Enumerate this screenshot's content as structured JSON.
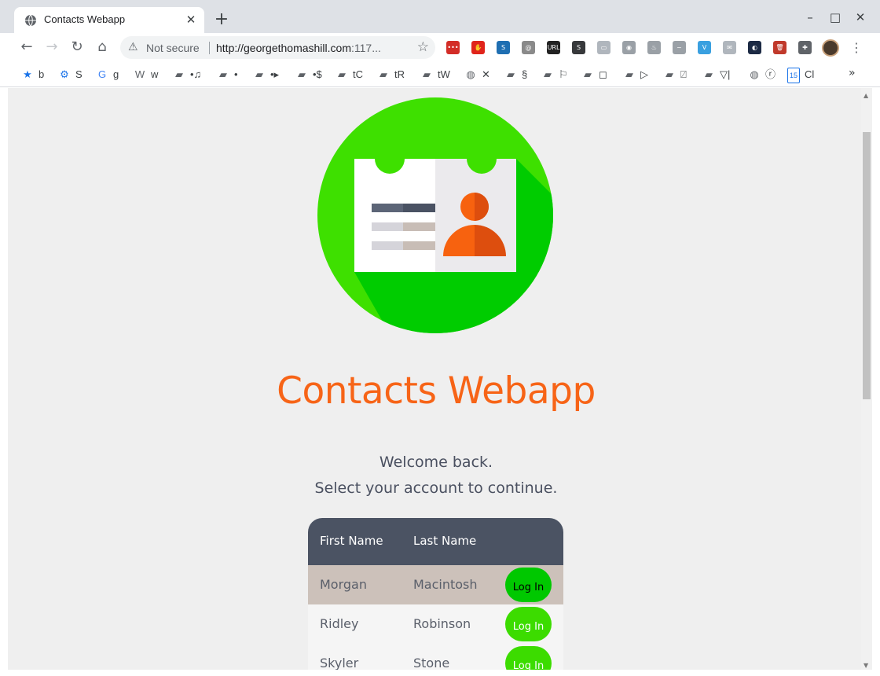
{
  "browser": {
    "tab_title": "Contacts Webapp",
    "tab_close": "✕",
    "new_tab": "+",
    "window_controls": {
      "minimize": "–",
      "maximize": "□",
      "close": "✕"
    },
    "nav": {
      "back": "←",
      "forward": "→",
      "reload": "↻",
      "home": "⌂"
    },
    "security_label": "Not secure",
    "url_host": "http://georgethomashill.com",
    "url_rest": ":117...",
    "star": "☆",
    "menu": "⋮",
    "extensions": [
      {
        "name": "lastpass-icon",
        "label": "•••",
        "color": "#d32d27"
      },
      {
        "name": "adblock-icon",
        "label": "✋",
        "color": "#e0241b"
      },
      {
        "name": "s-ext-icon",
        "label": "S",
        "color": "#1f6fb2"
      },
      {
        "name": "note-ext-icon",
        "label": "@",
        "color": "#8a8a8a"
      },
      {
        "name": "url-ext-icon",
        "label": "URL",
        "color": "#222222"
      },
      {
        "name": "s2-ext-icon",
        "label": "S",
        "color": "#37393b"
      },
      {
        "name": "card-ext-icon",
        "label": "▭",
        "color": "#b0b6bd"
      },
      {
        "name": "camera-ext-icon",
        "label": "◉",
        "color": "#9aa0a6"
      },
      {
        "name": "fire-ext-icon",
        "label": "♨",
        "color": "#9aa0a6"
      },
      {
        "name": "wave-ext-icon",
        "label": "~",
        "color": "#9aa0a6"
      },
      {
        "name": "v-ext-icon",
        "label": "V",
        "color": "#3aa0e0"
      },
      {
        "name": "mail-ext-icon",
        "label": "✉",
        "color": "#b0b6bd"
      },
      {
        "name": "moon-ext-icon",
        "label": "◐",
        "color": "#1c2a44"
      },
      {
        "name": "trash-ext-icon",
        "label": "🗑",
        "color": "#c0392b"
      },
      {
        "name": "puzzle-ext-icon",
        "label": "✚",
        "color": "#5f6368"
      }
    ]
  },
  "bookmarks": [
    {
      "icon": "★",
      "label": "b"
    },
    {
      "icon": "⚙",
      "label": "S"
    },
    {
      "icon": "G",
      "label": "g"
    },
    {
      "icon": "W",
      "label": "w"
    },
    {
      "icon": "▰",
      "label": "•♫"
    },
    {
      "icon": "▰",
      "label": "•"
    },
    {
      "icon": "▰",
      "label": "•▸"
    },
    {
      "icon": "▰",
      "label": "•$"
    },
    {
      "icon": "▰",
      "label": "tC"
    },
    {
      "icon": "▰",
      "label": "tR"
    },
    {
      "icon": "▰",
      "label": "tW"
    },
    {
      "icon": "◍",
      "label": "✕"
    },
    {
      "icon": "▰",
      "label": "§"
    },
    {
      "icon": "▰",
      "label": "⚐"
    },
    {
      "icon": "▰",
      "label": "◻"
    },
    {
      "icon": "▰",
      "label": "▷"
    },
    {
      "icon": "▰",
      "label": "⍁"
    },
    {
      "icon": "▰",
      "label": "▽|"
    },
    {
      "icon": "◍",
      "label": "ⓡ"
    },
    {
      "icon": "15",
      "label": "Cl"
    }
  ],
  "bookmarks_more": "»",
  "page": {
    "title": "Contacts Webapp",
    "welcome": "Welcome back.",
    "select_prompt": "Select your account to continue.",
    "table": {
      "headers": [
        "First Name",
        "Last Name",
        ""
      ],
      "login_label": "Log In",
      "rows": [
        {
          "first": "Morgan",
          "last": "Macintosh",
          "selected": true
        },
        {
          "first": "Ridley",
          "last": "Robinson",
          "selected": false
        },
        {
          "first": "Skyler",
          "last": "Stone",
          "selected": false
        }
      ]
    },
    "colors": {
      "accent_orange": "#f76417",
      "login_green": "#3cdc00",
      "header_slate": "#4b5363",
      "selected_row": "#ccc1ba"
    }
  }
}
